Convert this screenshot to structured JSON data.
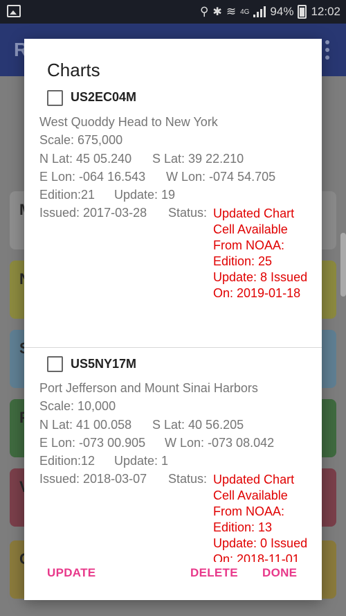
{
  "status_bar": {
    "battery": "94%",
    "time": "12:02",
    "network": "4G"
  },
  "background_app": {
    "title_initial": "R",
    "tiles": [
      "M",
      "N",
      "S",
      "F",
      "V",
      "C"
    ]
  },
  "dialog": {
    "title": "Charts",
    "charts": [
      {
        "id": "US2EC04M",
        "name": "West Quoddy Head to New York",
        "scale": "Scale: 675,000",
        "n_lat": "N Lat: 45 05.240",
        "s_lat": "S Lat: 39 22.210",
        "e_lon": "E Lon: -064 16.543",
        "w_lon": "W Lon: -074 54.705",
        "edition": "Edition:21",
        "update": "Update: 19",
        "issued": "Issued: 2017-03-28",
        "status_label": "Status:",
        "status_lines": [
          "Updated Chart",
          "Cell Available",
          "From NOAA:",
          "Edition: 25",
          "Update: 8 Issued",
          "On: 2019-01-18"
        ]
      },
      {
        "id": "US5NY17M",
        "name": "Port Jefferson and Mount Sinai Harbors",
        "scale": "Scale: 10,000",
        "n_lat": "N Lat: 41 00.058",
        "s_lat": "S Lat: 40 56.205",
        "e_lon": "E Lon: -073 00.905",
        "w_lon": "W Lon: -073 08.042",
        "edition": "Edition:12",
        "update": "Update: 1",
        "issued": "Issued: 2018-03-07",
        "status_label": "Status:",
        "status_lines": [
          "Updated Chart",
          "Cell Available",
          "From NOAA:",
          "Edition: 13",
          "Update: 0 Issued",
          "On: 2018-11-01"
        ]
      }
    ],
    "buttons": {
      "update": "UPDATE",
      "delete": "DELETE",
      "done": "DONE"
    }
  },
  "colors": {
    "accent": "#e8388a",
    "status_red": "#e00000",
    "appbar": "#283772"
  }
}
